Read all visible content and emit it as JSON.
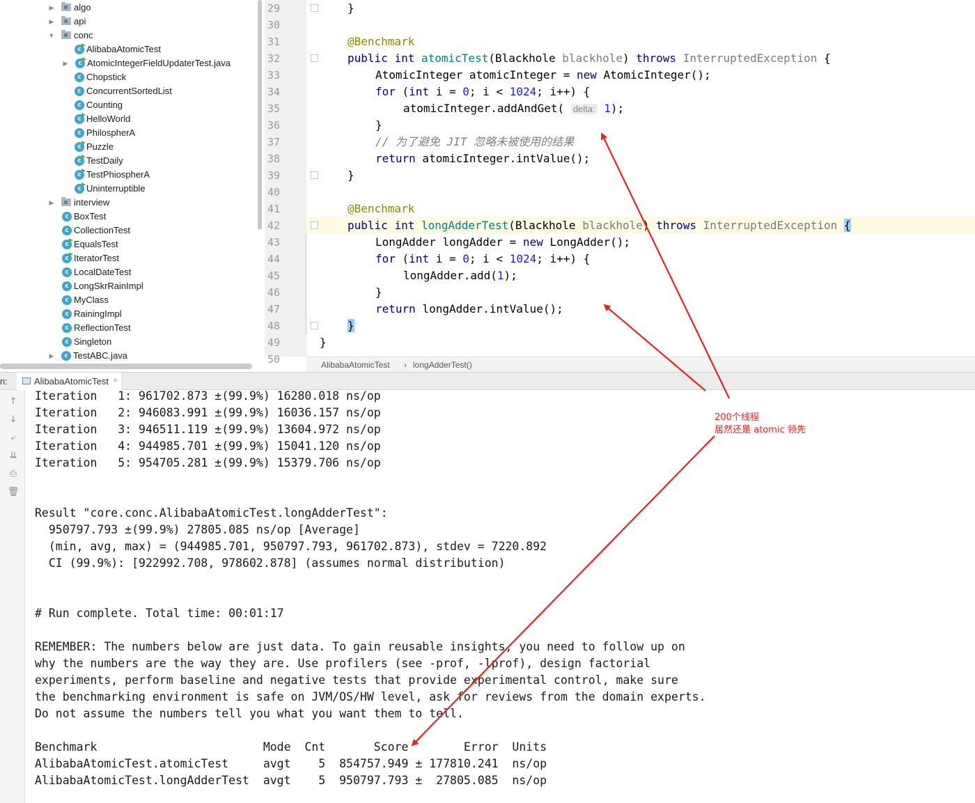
{
  "project_tree": {
    "items": [
      {
        "label": "algo",
        "type": "folder",
        "arrow": "▶",
        "icon": "package-folder-icon"
      },
      {
        "label": "api",
        "type": "folder",
        "arrow": "▶",
        "icon": "package-folder-icon"
      },
      {
        "label": "conc",
        "type": "folder",
        "arrow": "▼",
        "icon": "package-folder-icon"
      },
      {
        "label": "AlibabaAtomicTest",
        "type": "class",
        "icon": "class-runnable-icon"
      },
      {
        "label": "AtomicIntegerFieldUpdaterTest.java",
        "type": "class",
        "arrow": "▶",
        "icon": "class-runnable-icon"
      },
      {
        "label": "Chopstick",
        "type": "class",
        "icon": "class-icon"
      },
      {
        "label": "ConcurrentSortedList",
        "type": "class",
        "icon": "class-icon"
      },
      {
        "label": "Counting",
        "type": "class",
        "icon": "class-icon"
      },
      {
        "label": "HelloWorld",
        "type": "class",
        "icon": "class-runnable-icon"
      },
      {
        "label": "PhilospherA",
        "type": "class",
        "icon": "class-icon"
      },
      {
        "label": "Puzzle",
        "type": "class",
        "icon": "class-runnable-icon"
      },
      {
        "label": "TestDaily",
        "type": "class",
        "icon": "class-runnable-icon"
      },
      {
        "label": "TestPhiospherA",
        "type": "class",
        "icon": "class-runnable-icon"
      },
      {
        "label": "Uninterruptible",
        "type": "class",
        "icon": "class-runnable-icon"
      },
      {
        "label": "interview",
        "type": "folder",
        "arrow": "▶",
        "icon": "package-folder-icon"
      },
      {
        "label": "BoxTest",
        "type": "class",
        "icon": "class-icon"
      },
      {
        "label": "CollectionTest",
        "type": "class",
        "icon": "class-icon"
      },
      {
        "label": "EqualsTest",
        "type": "class",
        "icon": "class-runnable-icon"
      },
      {
        "label": "IteratorTest",
        "type": "class",
        "icon": "class-runnable-icon"
      },
      {
        "label": "LocalDateTest",
        "type": "class",
        "icon": "class-icon"
      },
      {
        "label": "LongSkrRainImpl",
        "type": "class",
        "icon": "class-icon"
      },
      {
        "label": "MyClass",
        "type": "class",
        "icon": "class-icon"
      },
      {
        "label": "RainingImpl",
        "type": "class",
        "icon": "class-icon"
      },
      {
        "label": "ReflectionTest",
        "type": "class",
        "icon": "class-icon"
      },
      {
        "label": "Singleton",
        "type": "class",
        "icon": "class-icon"
      },
      {
        "label": "TestABC.java",
        "type": "class",
        "arrow": "▶",
        "icon": "class-icon"
      }
    ]
  },
  "editor": {
    "line_numbers": [
      "29",
      "30",
      "31",
      "32",
      "33",
      "34",
      "35",
      "36",
      "37",
      "38",
      "39",
      "40",
      "41",
      "42",
      "43",
      "44",
      "45",
      "46",
      "47",
      "48",
      "49",
      "50"
    ],
    "tokens": {
      "l29_brace": "}",
      "l31_annotation": "@Benchmark",
      "l32_kw_public": "public",
      "l32_kw_int": "int",
      "l32_method": "atomicTest",
      "l32_paren_open": "(Blackhole ",
      "l32_param": "blackhole",
      "l32_paren_close": ") ",
      "l32_kw_throws": "throws",
      "l32_exception": "InterruptedException",
      "l32_brace": " {",
      "l33_type": "AtomicInteger atomicInteger = ",
      "l33_kw_new": "new",
      "l33_rest": " AtomicInteger();",
      "l34_kw_for": "for",
      "l34_a": " (",
      "l34_kw_int": "int",
      "l34_b": " i = ",
      "l34_num0": "0",
      "l34_c": "; i < ",
      "l34_num1024": "1024",
      "l34_d": "; i++) {",
      "l35_call": "atomicInteger.addAndGet( ",
      "l35_hint": "delta:",
      "l35_num": "1",
      "l35_end": ");",
      "l36_brace": "}",
      "l37_comment": "// 为了避免 JIT 忽略未被使用的结果",
      "l38_kw_return": "return",
      "l38_rest": " atomicInteger.intValue();",
      "l39_brace": "}",
      "l41_annotation": "@Benchmark",
      "l42_kw_public": "public",
      "l42_kw_int": "int",
      "l42_method": "longAdderTest",
      "l42_paren_open": "(Blackhole ",
      "l42_param": "blackhole",
      "l42_paren_close": ") ",
      "l42_kw_throws": "throws",
      "l42_exception": "InterruptedException",
      "l42_brace": "{",
      "l43_type": "LongAdder longAdder = ",
      "l43_kw_new": "new",
      "l43_rest": " LongAdder();",
      "l44_kw_for": "for",
      "l44_a": " (",
      "l44_kw_int": "int",
      "l44_b": " i = ",
      "l44_num0": "0",
      "l44_c": "; i < ",
      "l44_num1024": "1024",
      "l44_d": "; i++) {",
      "l45_call": "longAdder.add(",
      "l45_num": "1",
      "l45_end": ");",
      "l46_brace": "}",
      "l47_kw_return": "return",
      "l47_rest": " longAdder.intValue();",
      "l48_brace": "}",
      "l49_brace": "}"
    }
  },
  "breadcrumbs": {
    "class_name": "AlibabaAtomicTest",
    "separator": "›",
    "method_name": "longAdderTest()"
  },
  "run_window": {
    "label": "n:",
    "tab_label": "AlibabaAtomicTest",
    "tab_close": "×",
    "toolbar": [
      {
        "name": "scroll-up-icon",
        "glyph": "↑"
      },
      {
        "name": "scroll-down-icon",
        "glyph": "↓"
      },
      {
        "name": "soft-wrap-icon",
        "glyph": "⤶"
      },
      {
        "name": "scroll-to-end-icon",
        "glyph": "⇊"
      },
      {
        "name": "print-icon",
        "glyph": "⎙"
      },
      {
        "name": "trash-icon",
        "glyph": "🗑"
      }
    ]
  },
  "console": {
    "lines": [
      "Iteration   1: 961702.873 ±(99.9%) 16280.018 ns/op",
      "Iteration   2: 946083.991 ±(99.9%) 16036.157 ns/op",
      "Iteration   3: 946511.119 ±(99.9%) 13604.972 ns/op",
      "Iteration   4: 944985.701 ±(99.9%) 15041.120 ns/op",
      "Iteration   5: 954705.281 ±(99.9%) 15379.706 ns/op",
      "",
      "",
      "Result \"core.conc.AlibabaAtomicTest.longAdderTest\":",
      "  950797.793 ±(99.9%) 27805.085 ns/op [Average]",
      "  (min, avg, max) = (944985.701, 950797.793, 961702.873), stdev = 7220.892",
      "  CI (99.9%): [922992.708, 978602.878] (assumes normal distribution)",
      "",
      "",
      "# Run complete. Total time: 00:01:17",
      "",
      "REMEMBER: The numbers below are just data. To gain reusable insights, you need to follow up on",
      "why the numbers are the way they are. Use profilers (see -prof, -lprof), design factorial",
      "experiments, perform baseline and negative tests that provide experimental control, make sure",
      "the benchmarking environment is safe on JVM/OS/HW level, ask for reviews from the domain experts.",
      "Do not assume the numbers tell you what you want them to tell.",
      "",
      "Benchmark                        Mode  Cnt       Score        Error  Units",
      "AlibabaAtomicTest.atomicTest     avgt    5  854757.949 ± 177810.241  ns/op",
      "AlibabaAtomicTest.longAdderTest  avgt    5  950797.793 ±  27805.085  ns/op"
    ]
  },
  "annotation": {
    "line1": "200个线程",
    "line2": "居然还是 atomic 领先",
    "color": "#e8231f"
  },
  "colors": {
    "keyword": "#00007f",
    "annotation": "#8a8a00",
    "method": "#008080",
    "number": "#1c1cf0",
    "comment": "#808080",
    "current_line": "#fdfce1",
    "bracket_highlight": "#99ccff"
  }
}
